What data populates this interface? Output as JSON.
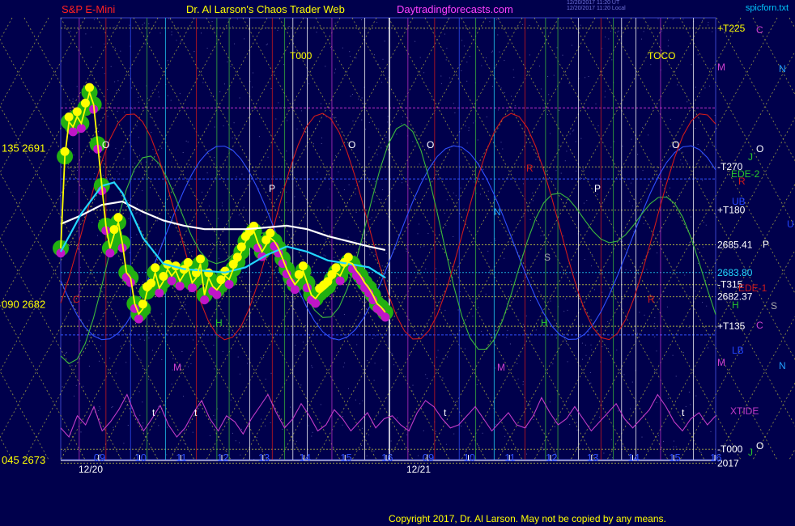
{
  "header": {
    "instrument": "S&P E-Mini",
    "author": "Dr. Al Larson's Chaos Trader Web",
    "site": "Daytradingforecasts.com",
    "timestamp_line1": "12/20/2017 11:20 UT",
    "timestamp_line2": "12/20/2017 11:20 Local",
    "signature": "spicforn.txt"
  },
  "footer": {
    "copyright": "Copyright 2017, Dr. Al Larson. May not be copied by any means."
  },
  "colors": {
    "background": "#00004c",
    "price_line": "#ffff00",
    "moving_avg_cyan": "#22d7ff",
    "moving_avg_white": "#ffffff",
    "green_glow": "#22b011",
    "magenta_dots": "#c015c8",
    "yellow_dots": "#ffff00",
    "flux_green": "#3cb93c",
    "flux_red": "#d11a1a",
    "xtide": "#c23bc8"
  },
  "chart_data": {
    "type": "line",
    "title": "S&P E-Mini",
    "y_axis_left": {
      "ticks": [
        {
          "label": "135 2691",
          "value": 2691
        },
        {
          "label": "090 2682",
          "value": 2682
        },
        {
          "label": "045 2673",
          "value": 2673
        }
      ],
      "ylim": [
        2673,
        2698.5
      ]
    },
    "x_axis": {
      "hour_ticks": [
        "09",
        "10",
        "11",
        "12",
        "13",
        "14",
        "15",
        "16",
        "09",
        "10",
        "11",
        "12",
        "13",
        "14",
        "15",
        "16"
      ],
      "date_labels": [
        "12/20",
        "12/21"
      ]
    },
    "right_labels": [
      {
        "text": "+T225",
        "color": "#ffff00",
        "value": 2697.9
      },
      {
        "text": "-T270",
        "color": "#ffffff",
        "value": 2689.9
      },
      {
        "text": "+T180",
        "color": "#ffffff",
        "value": 2687.4
      },
      {
        "text": "2685.41",
        "color": "#ffffff",
        "value": 2685.4
      },
      {
        "text": "2683.80",
        "color": "#22d7ff",
        "value": 2683.8
      },
      {
        "text": "-T315",
        "color": "#ffffff",
        "value": 2683.1
      },
      {
        "text": "2682.37",
        "color": "#ffffff",
        "value": 2682.4
      },
      {
        "text": "+T135",
        "color": "#ffffff",
        "value": 2680.7
      },
      {
        "text": "-T000",
        "color": "#ffffff",
        "value": 2673.6
      },
      {
        "text": "2017",
        "color": "#ffffff",
        "value": 2672.8
      }
    ],
    "side_labels": [
      {
        "text": "C",
        "color": "#d040d0"
      },
      {
        "text": "N",
        "color": "#22a0ff"
      },
      {
        "text": "M",
        "color": "#d040d0"
      },
      {
        "text": "O",
        "color": "#ffffff"
      },
      {
        "text": "J",
        "color": "#2ac92a"
      },
      {
        "text": "EDE-2",
        "color": "#2ac92a"
      },
      {
        "text": "R",
        "color": "#d11a1a"
      },
      {
        "text": "UB",
        "color": "#2244ff"
      },
      {
        "text": "U",
        "color": "#2244ff"
      },
      {
        "text": "P",
        "color": "#ffffff"
      },
      {
        "text": "EDE-1",
        "color": "#d11a1a"
      },
      {
        "text": "H",
        "color": "#2ac92a"
      },
      {
        "text": "S",
        "color": "#aaaaaa"
      },
      {
        "text": "C",
        "color": "#d040d0"
      },
      {
        "text": "LB",
        "color": "#2244ff"
      },
      {
        "text": "N",
        "color": "#22a0ff"
      },
      {
        "text": "M",
        "color": "#d040d0"
      },
      {
        "text": "XTIDE",
        "color": "#c23bc8"
      },
      {
        "text": "O",
        "color": "#ffffff"
      },
      {
        "text": "J",
        "color": "#2ac92a"
      }
    ],
    "chart_markers": [
      {
        "text": "T000",
        "color": "#ffff00"
      },
      {
        "text": "TOCO",
        "color": "#ffff00"
      },
      {
        "text": "O",
        "color": "#ffffff"
      },
      {
        "text": "O",
        "color": "#ffffff"
      },
      {
        "text": "O",
        "color": "#ffffff"
      },
      {
        "text": "O",
        "color": "#ffffff"
      },
      {
        "text": "P",
        "color": "#ffffff"
      },
      {
        "text": "P",
        "color": "#ffffff"
      },
      {
        "text": "N",
        "color": "#22a0ff"
      },
      {
        "text": "S",
        "color": "#aaaaaa"
      },
      {
        "text": "R",
        "color": "#d11a1a"
      },
      {
        "text": "R",
        "color": "#d11a1a"
      },
      {
        "text": "H",
        "color": "#2ac92a"
      },
      {
        "text": "H",
        "color": "#2ac92a"
      },
      {
        "text": "M",
        "color": "#d040d0"
      },
      {
        "text": "M",
        "color": "#d040d0"
      },
      {
        "text": "C",
        "color": "#d11a1a"
      },
      {
        "text": "t",
        "color": "#ffffff"
      },
      {
        "text": "t",
        "color": "#ffffff"
      },
      {
        "text": "t",
        "color": "#ffffff"
      },
      {
        "text": "t",
        "color": "#ffffff"
      }
    ],
    "series": [
      {
        "name": "price",
        "x": [
          0.0,
          0.1,
          0.2,
          0.3,
          0.4,
          0.5,
          0.6,
          0.7,
          0.8,
          0.9,
          1.0,
          1.1,
          1.2,
          1.3,
          1.4,
          1.5,
          1.6,
          1.7,
          1.8,
          1.9,
          2.0,
          2.1,
          2.2,
          2.3,
          2.4,
          2.5,
          2.6,
          2.7,
          2.8,
          2.9,
          3.0,
          3.1,
          3.2,
          3.3,
          3.4,
          3.5,
          3.6,
          3.7,
          3.8,
          3.9,
          4.0,
          4.1,
          4.2,
          4.3,
          4.4,
          4.5,
          4.6,
          4.7,
          4.8,
          4.9,
          5.0,
          5.1,
          5.2,
          5.3,
          5.4,
          5.5,
          5.6,
          5.7,
          5.8,
          5.9,
          6.0,
          6.1,
          6.2,
          6.3,
          6.4,
          6.5,
          6.6,
          6.7,
          6.8,
          6.9,
          7.0,
          7.1,
          7.2,
          7.3,
          7.4,
          7.5,
          7.6,
          7.7,
          7.8,
          7.9
        ],
        "values": [
          2685.2,
          2690.5,
          2692.5,
          2692.2,
          2692.8,
          2692.4,
          2693.3,
          2694.2,
          2693.5,
          2691.2,
          2688.8,
          2686.5,
          2685.2,
          2686.0,
          2686.7,
          2685.5,
          2683.8,
          2683.5,
          2682.0,
          2681.4,
          2681.7,
          2682.7,
          2682.9,
          2683.8,
          2682.9,
          2683.3,
          2684.0,
          2683.6,
          2683.9,
          2683.3,
          2683.7,
          2684.1,
          2683.2,
          2683.5,
          2684.3,
          2682.5,
          2683.5,
          2683.0,
          2682.8,
          2683.1,
          2683.6,
          2683.4,
          2684.0,
          2684.4,
          2685.0,
          2685.6,
          2685.9,
          2686.2,
          2685.5,
          2685.0,
          2685.4,
          2685.8,
          2685.6,
          2685.2,
          2684.6,
          2684.0,
          2683.5,
          2683.1,
          2683.4,
          2683.9,
          2683.2,
          2682.5,
          2682.3,
          2682.6,
          2682.8,
          2683.0,
          2683.4,
          2683.8,
          2683.6,
          2684.1,
          2684.4,
          2684.3,
          2683.9,
          2683.6,
          2683.2,
          2682.9,
          2682.5,
          2682.0,
          2681.8,
          2681.5
        ]
      },
      {
        "name": "moving average (cyan)",
        "x": [
          0.0,
          0.5,
          1.0,
          1.3,
          1.5,
          2.0,
          2.5,
          3.0,
          3.5,
          4.0,
          4.5,
          5.0,
          5.5,
          6.0,
          6.5,
          7.0,
          7.5,
          7.9
        ],
        "values": [
          2685.0,
          2687.2,
          2688.8,
          2689.0,
          2688.4,
          2685.8,
          2684.3,
          2684.0,
          2683.9,
          2683.8,
          2684.1,
          2684.8,
          2685.3,
          2685.0,
          2684.5,
          2684.3,
          2684.1,
          2683.5
        ]
      },
      {
        "name": "moving average (white)",
        "x": [
          0.0,
          0.5,
          1.0,
          1.5,
          2.0,
          2.5,
          3.0,
          3.5,
          4.0,
          4.5,
          5.0,
          5.5,
          6.0,
          6.5,
          7.0,
          7.5,
          7.9
        ],
        "values": [
          2686.6,
          2687.1,
          2687.7,
          2687.9,
          2687.3,
          2686.8,
          2686.5,
          2686.3,
          2686.3,
          2686.3,
          2686.4,
          2686.5,
          2686.3,
          2685.9,
          2685.6,
          2685.3,
          2685.1
        ]
      }
    ],
    "xtide": [
      0.35,
      0.2,
      0.55,
      0.4,
      0.7,
      0.3,
      0.45,
      0.65,
      0.9,
      0.55,
      0.3,
      0.5,
      0.72,
      0.4,
      0.2,
      0.35,
      0.6,
      0.8,
      0.5,
      0.3,
      0.55,
      0.45,
      0.25,
      0.5,
      0.7,
      0.9,
      0.6,
      0.35,
      0.5,
      0.75,
      0.55,
      0.3,
      0.4,
      0.65,
      0.5,
      0.3,
      0.45,
      0.6,
      0.35,
      0.5,
      0.55,
      0.4,
      0.3,
      0.6,
      0.8,
      0.7,
      0.5,
      0.35,
      0.4,
      0.55,
      0.7,
      0.5,
      0.3,
      0.45,
      0.6,
      0.4,
      0.35,
      0.55,
      0.85,
      0.6,
      0.4,
      0.5,
      0.7,
      0.5,
      0.3,
      0.45,
      0.6,
      0.75,
      0.5,
      0.35,
      0.5,
      0.65,
      0.9,
      0.7,
      0.45,
      0.3,
      0.5,
      0.6,
      0.4,
      0.55
    ],
    "grid": true,
    "legend": "none"
  }
}
